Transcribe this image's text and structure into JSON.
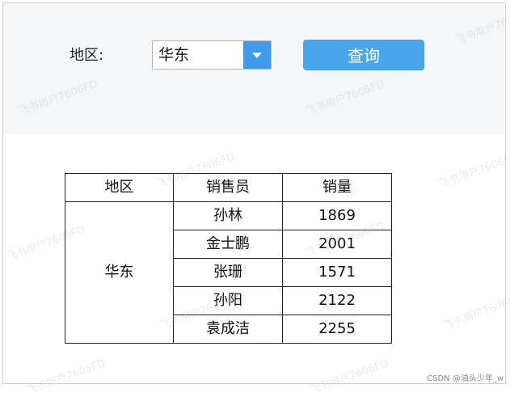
{
  "filter": {
    "region_label": "地区:",
    "region_selected": "华东",
    "query_button": "查询"
  },
  "table": {
    "headers": [
      "地区",
      "销售员",
      "销量"
    ],
    "region": "华东",
    "rows": [
      {
        "salesperson": "孙林",
        "sales": "1869"
      },
      {
        "salesperson": "金士鹏",
        "sales": "2001"
      },
      {
        "salesperson": "张珊",
        "sales": "1571"
      },
      {
        "salesperson": "孙阳",
        "sales": "2122"
      },
      {
        "salesperson": "袁成洁",
        "sales": "2255"
      }
    ]
  },
  "watermark": "飞书用户7606FD",
  "footer": "CSDN @油头少年_w",
  "colors": {
    "accent": "#3d9be9",
    "button": "#4aa6ea",
    "panel_bg": "#f5f6f8"
  },
  "icons": {
    "dropdown": "chevron-down-icon"
  }
}
